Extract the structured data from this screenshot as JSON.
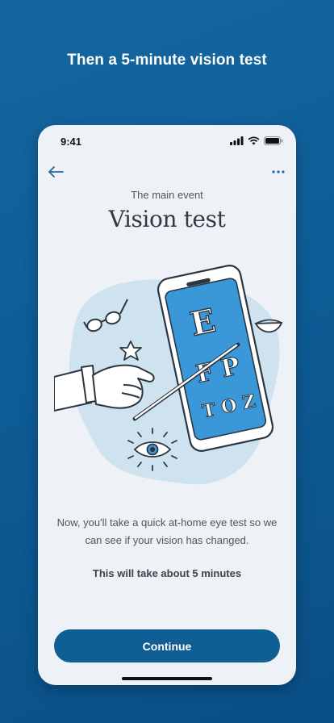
{
  "headline": "Then a 5-minute vision test",
  "status_bar": {
    "time": "9:41"
  },
  "nav": {
    "back_icon": "arrow-left-icon",
    "more_icon": "more-dots-icon"
  },
  "screen": {
    "eyebrow": "The main event",
    "title": "Vision test",
    "chart_letters": {
      "row1": "E",
      "row2": "F P",
      "row3": "T O Z"
    },
    "body": "Now, you'll take a quick at-home eye test so we can see if your vision has changed.",
    "duration": "This will take about 5 minutes",
    "continue_label": "Continue"
  },
  "colors": {
    "background": "#0e5d96",
    "card": "#eef1f5",
    "accent": "#0f5e94",
    "phone_screen": "#3a97d8",
    "blob": "#cfe2ef"
  }
}
